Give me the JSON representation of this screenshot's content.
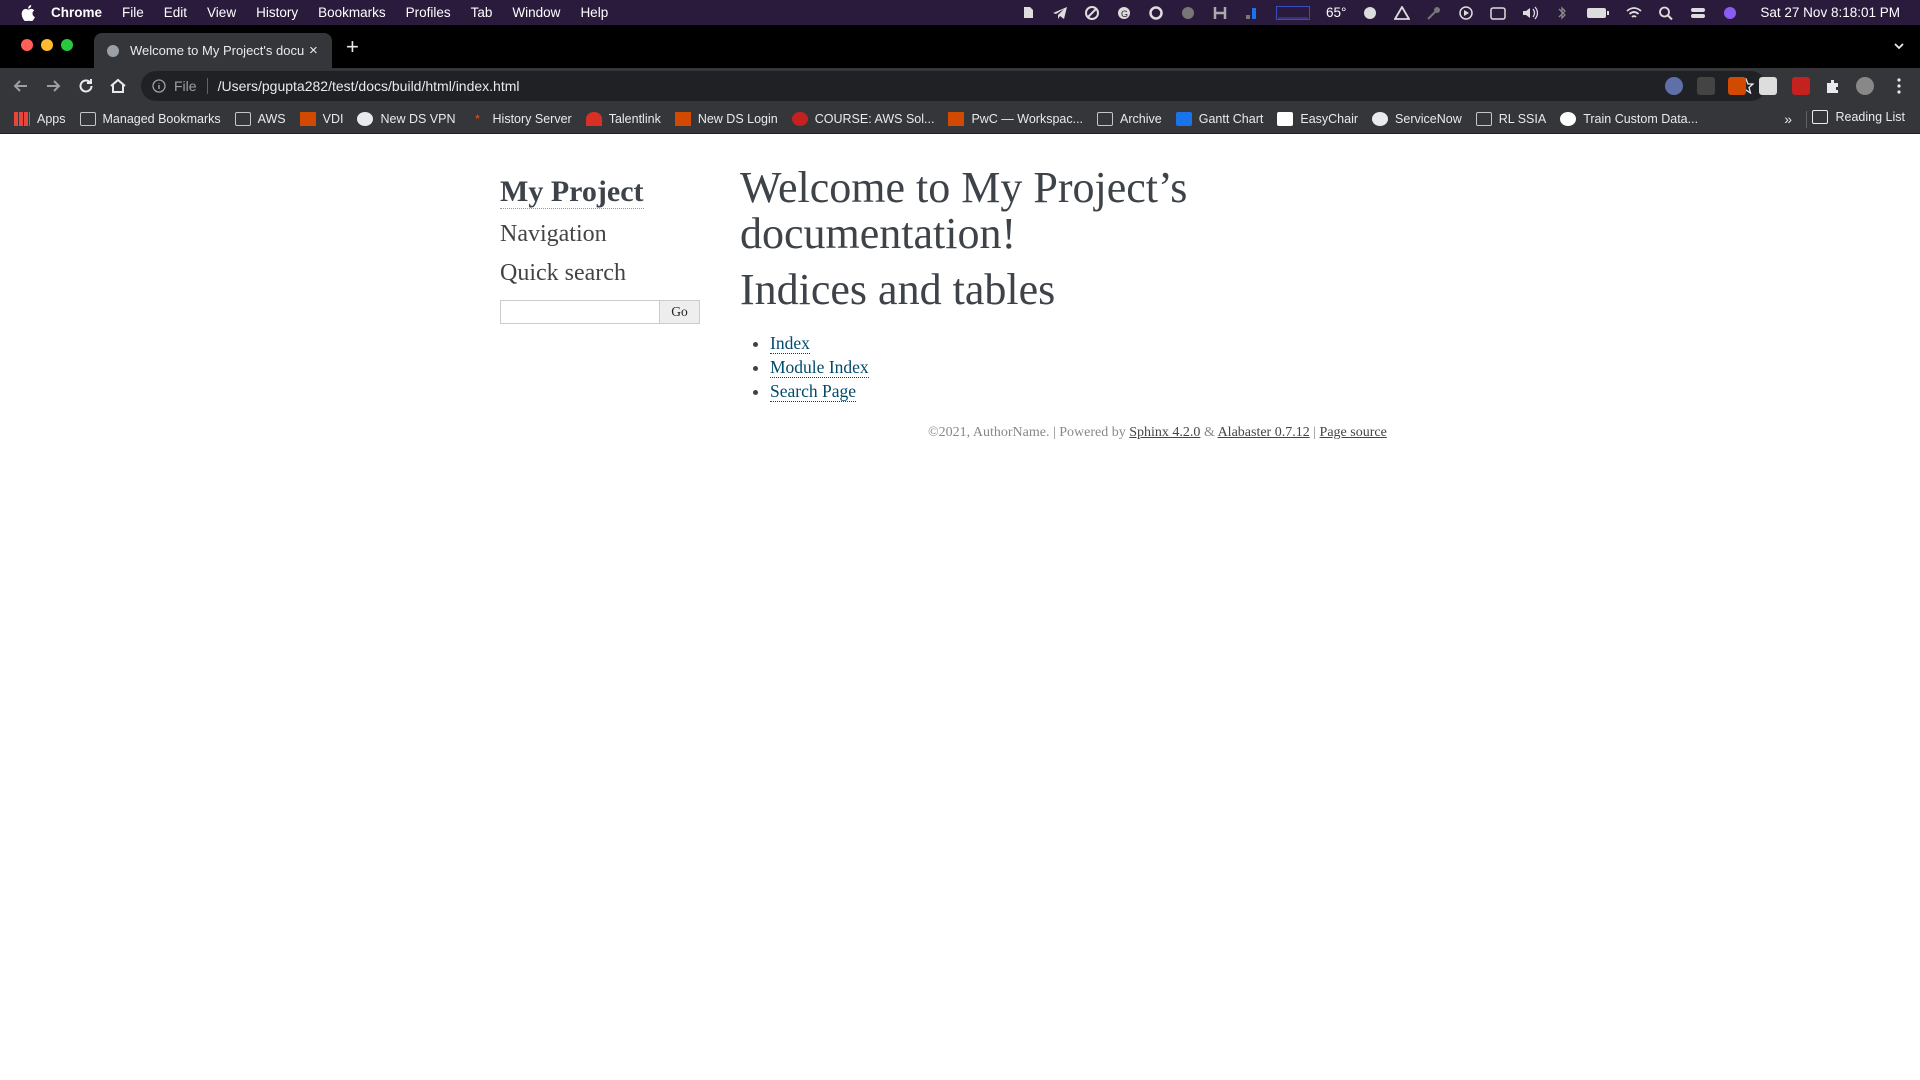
{
  "menubar": {
    "app": "Chrome",
    "items": [
      "File",
      "Edit",
      "View",
      "History",
      "Bookmarks",
      "Profiles",
      "Tab",
      "Window",
      "Help"
    ],
    "temperature": "65°",
    "datetime": "Sat 27 Nov  8:18:01 PM"
  },
  "tab": {
    "title": "Welcome to My Project's docu",
    "close": "×",
    "new_tab": "+"
  },
  "omnibox": {
    "scheme": "File",
    "url": "/Users/pgupta282/test/docs/build/html/index.html"
  },
  "bookmarks": {
    "items": [
      {
        "label": "Apps",
        "icon": "apps-grid-icon",
        "color": "#e8453c"
      },
      {
        "label": "Managed Bookmarks",
        "icon": "managed-folder-icon",
        "color": "#c5c5c5"
      },
      {
        "label": "AWS",
        "icon": "folder-icon",
        "color": "#c5c5c5"
      },
      {
        "label": "VDI",
        "icon": "pwc-icon",
        "color": "#d04a02"
      },
      {
        "label": "New DS VPN",
        "icon": "globe-icon",
        "color": "#e8eaed"
      },
      {
        "label": "History Server",
        "icon": "spark-icon",
        "color": "#e25a1c"
      },
      {
        "label": "Talentlink",
        "icon": "talentlink-icon",
        "color": "#d93025"
      },
      {
        "label": "New DS Login",
        "icon": "pwc-icon",
        "color": "#d04a02"
      },
      {
        "label": "COURSE: AWS Sol...",
        "icon": "course-icon",
        "color": "#c5221f"
      },
      {
        "label": "PwC — Workspac...",
        "icon": "pwc-icon",
        "color": "#d04a02"
      },
      {
        "label": "Archive",
        "icon": "folder-icon",
        "color": "#c5c5c5"
      },
      {
        "label": "Gantt Chart",
        "icon": "gantt-icon",
        "color": "#1a73e8"
      },
      {
        "label": "EasyChair",
        "icon": "easychair-icon",
        "color": "#ffffff"
      },
      {
        "label": "ServiceNow",
        "icon": "globe-icon",
        "color": "#e8eaed"
      },
      {
        "label": "RL SSIA",
        "icon": "folder-icon",
        "color": "#c5c5c5"
      },
      {
        "label": "Train Custom Data...",
        "icon": "github-icon",
        "color": "#ffffff"
      }
    ],
    "more": "»",
    "reading_list": "Reading List"
  },
  "page": {
    "project_title": "My Project",
    "navigation_heading": "Navigation",
    "quick_search_heading": "Quick search",
    "go_label": "Go",
    "h1": "Welcome to My Project’s documentation!",
    "h2": "Indices and tables",
    "links": [
      "Index",
      "Module Index",
      "Search Page"
    ],
    "footer": {
      "copyright": "©2021, AuthorName. | Powered by ",
      "sphinx": "Sphinx 4.2.0",
      "amp": " & ",
      "alabaster": "Alabaster 0.7.12",
      "pipe": " | ",
      "source": "Page source"
    }
  }
}
